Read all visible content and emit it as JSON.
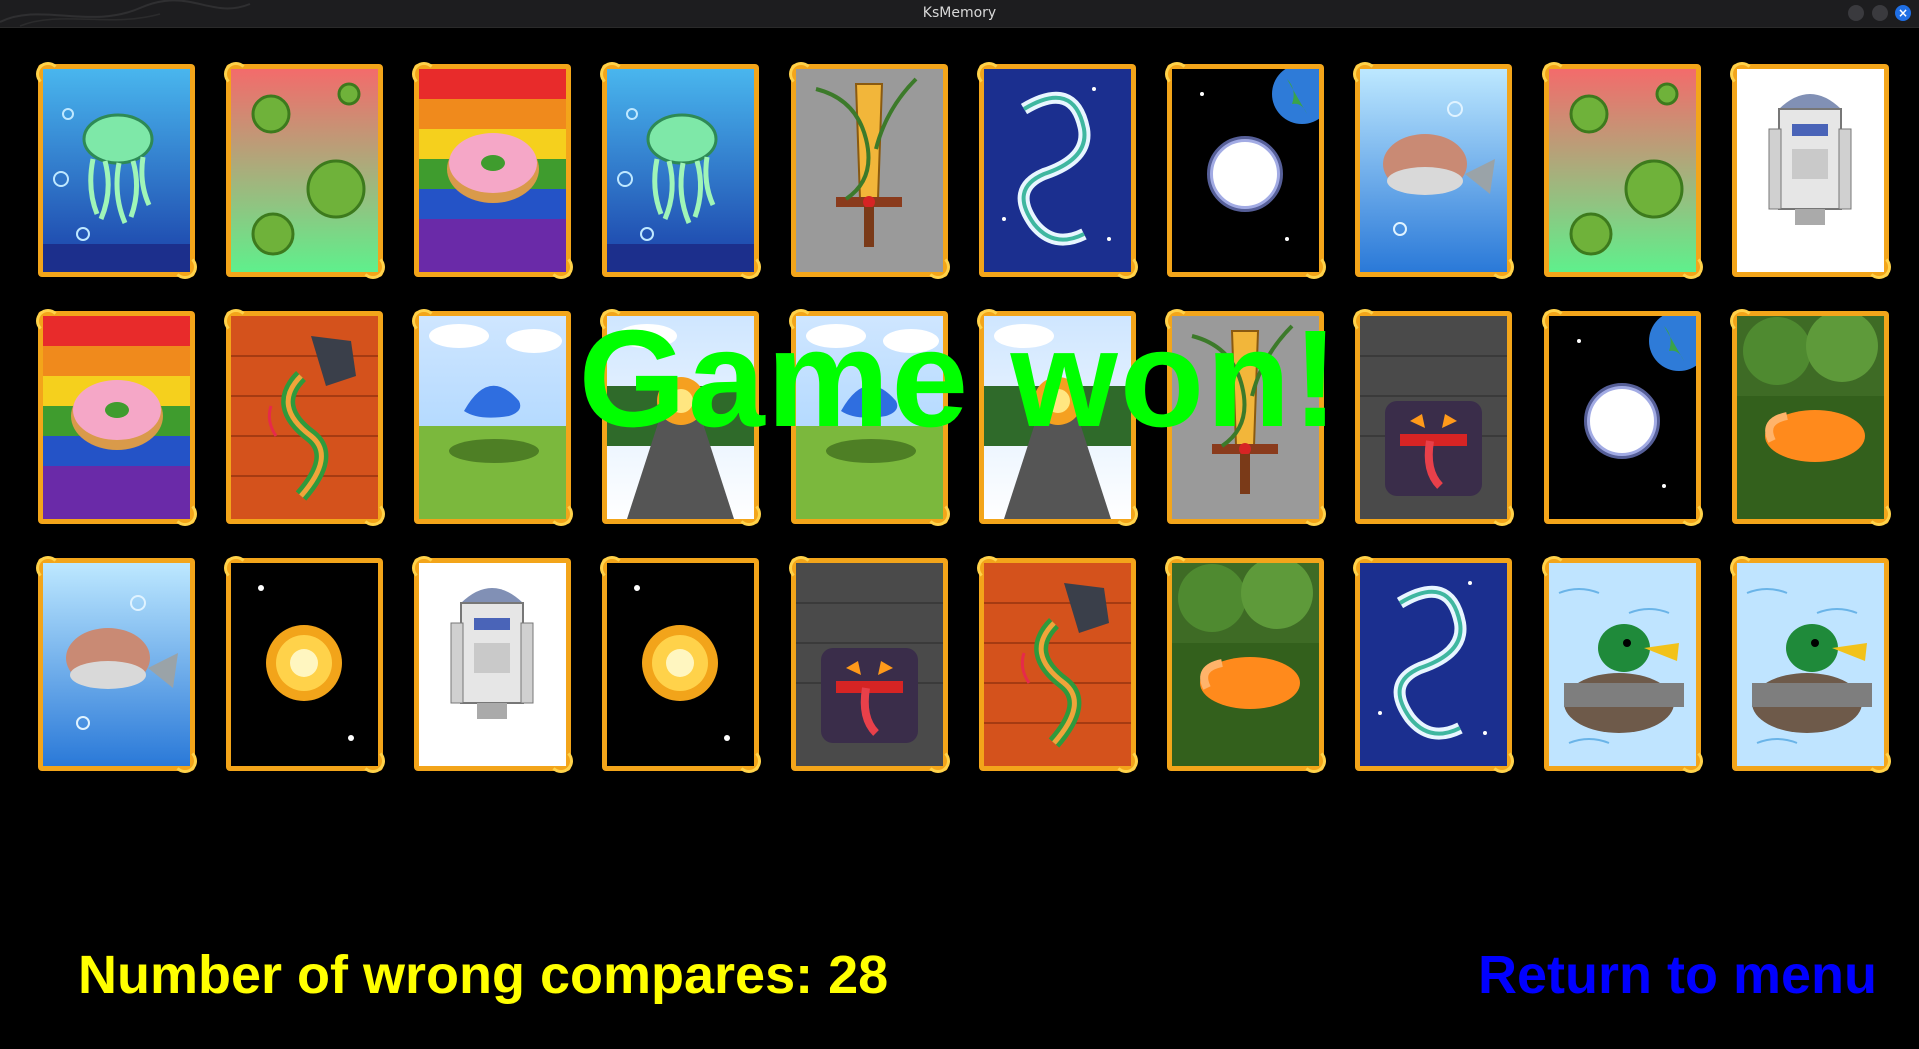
{
  "window": {
    "title": "KsMemory"
  },
  "board": {
    "rows": [
      [
        "jellyfish",
        "virus",
        "donut",
        "jellyfish",
        "sword",
        "dragon",
        "moon",
        "pufferfish",
        "virus",
        "r2d2"
      ],
      [
        "donut",
        "snake",
        "slime",
        "volcano",
        "slime",
        "volcano",
        "sword",
        "monster",
        "moon",
        "fox"
      ],
      [
        "pufferfish",
        "sun",
        "r2d2",
        "sun",
        "monster",
        "snake",
        "fox",
        "dragon",
        "duck",
        "duck"
      ]
    ],
    "state": "all-revealed"
  },
  "overlay": {
    "message": "Game won!",
    "color": "#00ff00"
  },
  "footer": {
    "wrong_compares_label": "Number of wrong compares: 28",
    "wrong_compares_count": 28,
    "return_label": "Return to menu"
  },
  "colors": {
    "card_frame": "#f3a51a",
    "stat_text": "#ffff00",
    "link_text": "#0000ff",
    "background": "#000000"
  }
}
